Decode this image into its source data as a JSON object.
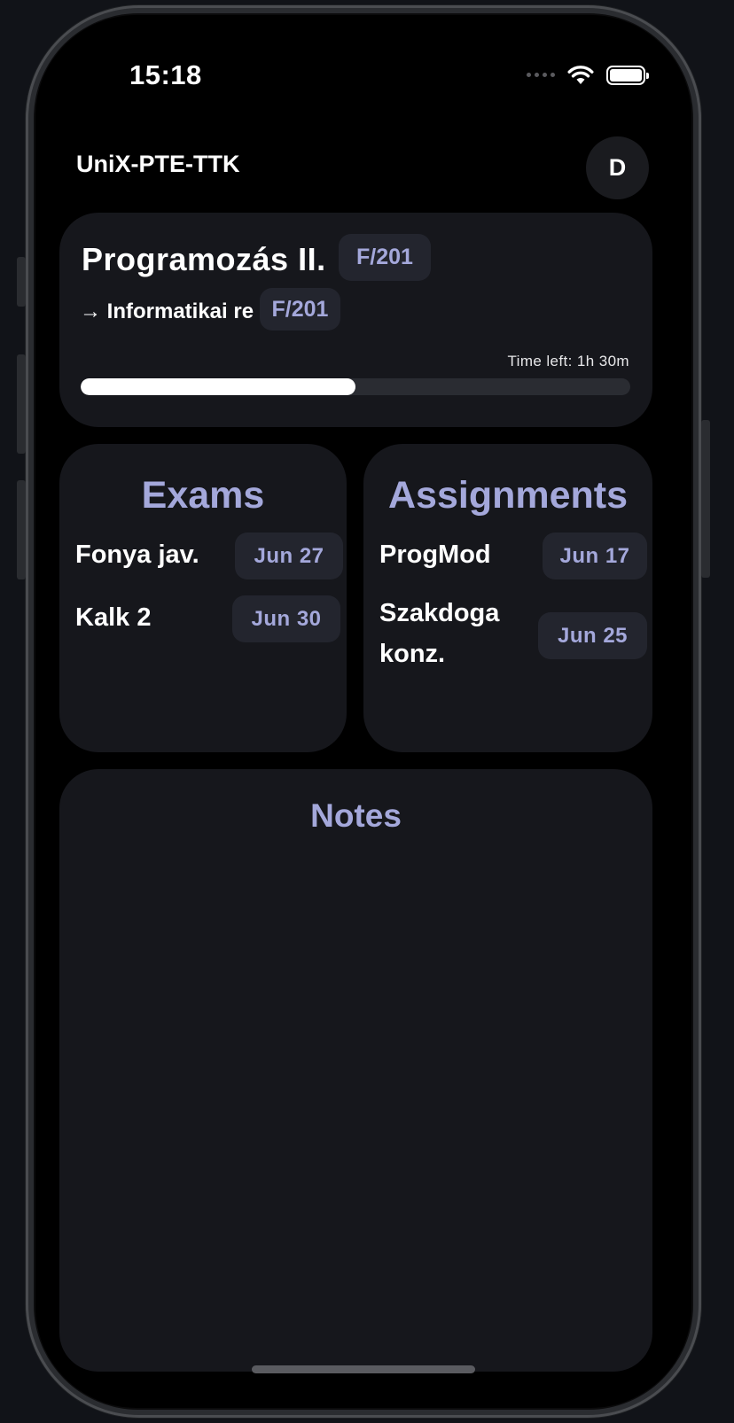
{
  "status": {
    "time": "15:18",
    "icons": [
      "signal-dots-icon",
      "wifi-icon",
      "battery-icon"
    ]
  },
  "header": {
    "title": "UniX-PTE-TTK",
    "avatar_initial": "D"
  },
  "current_class": {
    "name": "Programozás II.",
    "room": "F/201",
    "next_label": "→ Informatikai re",
    "next_room": "F/201",
    "time_left": "Time left: 1h 30m",
    "progress": 0.5
  },
  "exams": {
    "title": "Exams",
    "items": [
      {
        "name": "Fonya jav.",
        "date": "Jun 27"
      },
      {
        "name": "Kalk 2",
        "date": "Jun 30"
      }
    ]
  },
  "assignments": {
    "title": "Assignments",
    "items": [
      {
        "name": "ProgMod",
        "date": "Jun 17"
      },
      {
        "name": "Szakdoga konz.",
        "date": "Jun 25"
      }
    ]
  },
  "notes": {
    "title": "Notes"
  },
  "colors": {
    "accent": "#a4a8db",
    "card_bg": "#16171c",
    "pill_bg": "#23252e",
    "screen_bg": "#000000"
  }
}
